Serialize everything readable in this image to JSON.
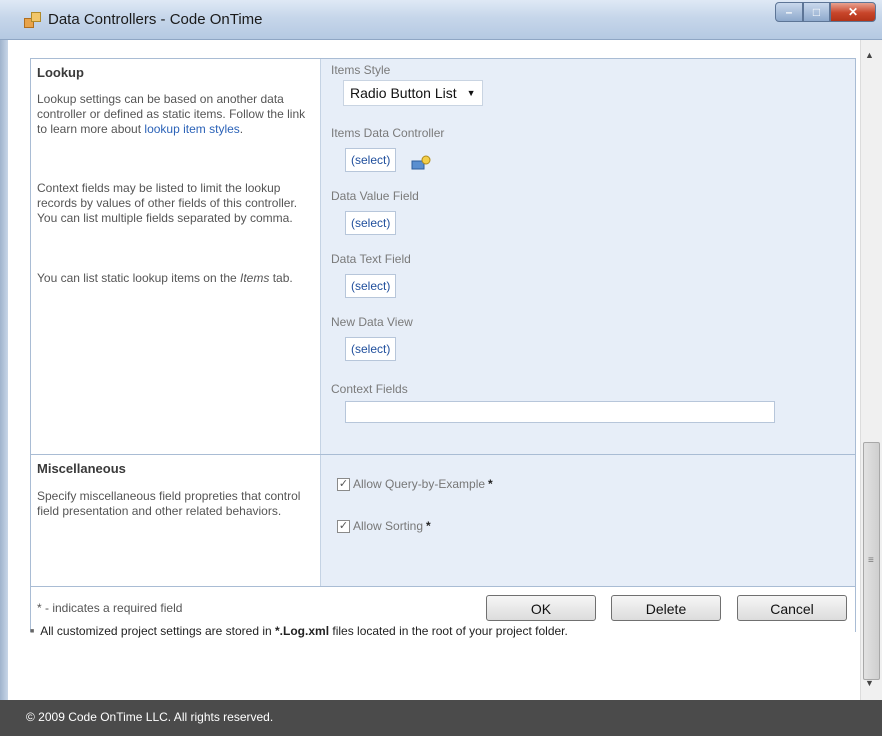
{
  "window": {
    "title": "Data Controllers - Code OnTime",
    "icon": "app-icon",
    "minimize_icon": "minimize-icon",
    "maximize_icon": "maximize-icon",
    "close_icon": "close-icon"
  },
  "lookup": {
    "title": "Lookup",
    "desc1_prefix": "Lookup settings can be based on another data controller or defined as static items. Follow the link to learn more about ",
    "desc1_link": "lookup item styles",
    "desc1_suffix": ".",
    "desc2": "Context fields may be listed to limit the lookup records by values of other fields of this controller. You can list multiple fields separated by comma.",
    "desc3_prefix": "You can list static lookup items on the ",
    "desc3_italic": "Items",
    "desc3_suffix": " tab.",
    "items_style_label": "Items Style",
    "items_style_value": "Radio Button List",
    "items_data_controller_label": "Items Data Controller",
    "data_value_field_label": "Data Value Field",
    "data_text_field_label": "Data Text Field",
    "new_data_view_label": "New Data View",
    "context_fields_label": "Context Fields",
    "context_fields_value": "",
    "select_label": "(select)"
  },
  "misc": {
    "title": "Miscellaneous",
    "desc": "Specify miscellaneous field propreties that control field presentation and other related behaviors.",
    "allow_qbe_label": "Allow Query-by-Example",
    "allow_qbe_checked": true,
    "allow_sorting_label": "Allow Sorting",
    "allow_sorting_checked": true,
    "required_mark": "*"
  },
  "footer": {
    "required_note": "* - indicates a required field",
    "ok_label": "OK",
    "delete_label": "Delete",
    "cancel_label": "Cancel"
  },
  "note": {
    "prefix": "All customized project settings are stored in ",
    "bold": "*.Log.xml",
    "suffix": " files located in the root of your project folder."
  },
  "status": {
    "copyright": "© 2009 Code OnTime LLC. All rights reserved."
  }
}
